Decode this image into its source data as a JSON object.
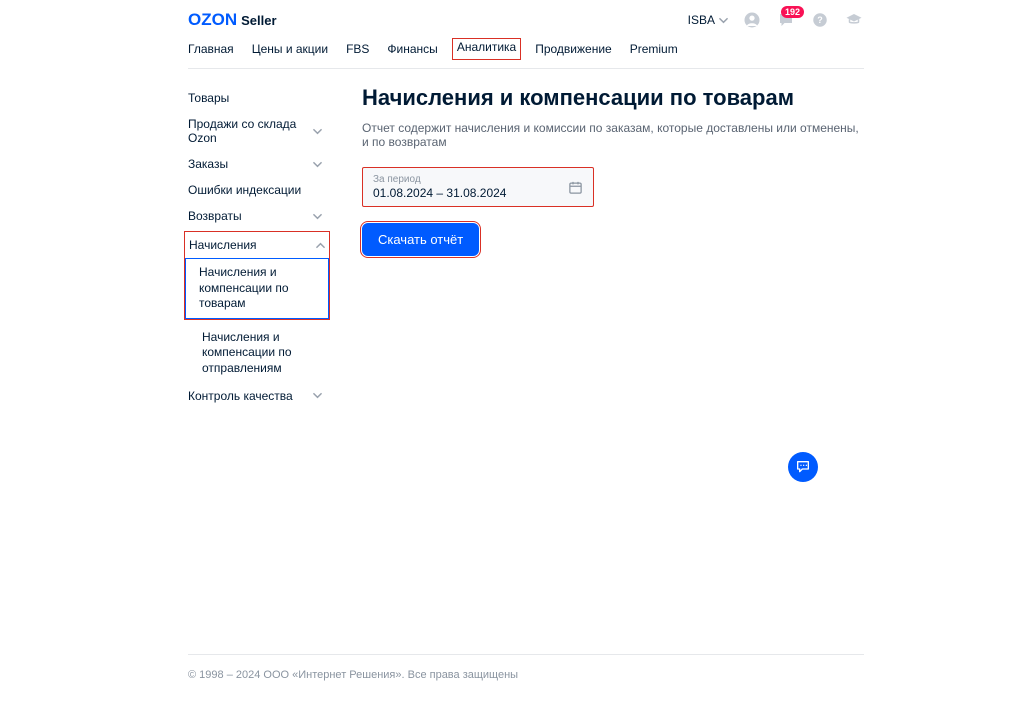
{
  "header": {
    "logo_ozon": "OZON",
    "logo_seller": "Seller",
    "account": "ISBA",
    "badge_count": "192"
  },
  "nav": {
    "items": [
      "Главная",
      "Цены и акции",
      "FBS",
      "Финансы",
      "Аналитика",
      "Продвижение",
      "Premium"
    ],
    "active_index": 4
  },
  "sidebar": {
    "items": [
      {
        "label": "Товары",
        "expandable": false
      },
      {
        "label": "Продажи со склада Ozon",
        "expandable": true
      },
      {
        "label": "Заказы",
        "expandable": true
      },
      {
        "label": "Ошибки индексации",
        "expandable": false
      },
      {
        "label": "Возвраты",
        "expandable": true
      }
    ],
    "accruals": {
      "label": "Начисления",
      "sub": [
        "Начисления и компенсации по товарам",
        "Начисления и компенсации по отправлениям"
      ],
      "active_sub": 0
    },
    "last": {
      "label": "Контроль качества",
      "expandable": true
    }
  },
  "main": {
    "title": "Начисления и компенсации по товарам",
    "description": "Отчет содержит начисления и комиссии по заказам, которые доставлены или отменены, и по возвратам",
    "period_label": "За период",
    "period_value": "01.08.2024 – 31.08.2024",
    "download_label": "Скачать отчёт"
  },
  "footer": {
    "text": "© 1998 – 2024 ООО «Интернет Решения». Все права защищены"
  }
}
